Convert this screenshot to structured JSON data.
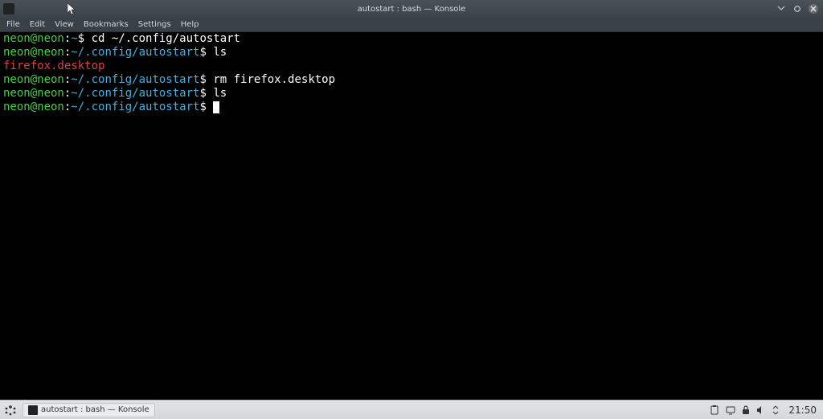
{
  "titlebar": {
    "title": "autostart : bash — Konsole"
  },
  "menubar": {
    "items": [
      "File",
      "Edit",
      "View",
      "Bookmarks",
      "Settings",
      "Help"
    ]
  },
  "terminal": {
    "lines": [
      {
        "user": "neon@neon",
        "path": "~",
        "command": "cd ~/.config/autostart"
      },
      {
        "user": "neon@neon",
        "path": "~/.config/autostart",
        "command": "ls"
      },
      {
        "output": "firefox.desktop",
        "class": "out-red"
      },
      {
        "user": "neon@neon",
        "path": "~/.config/autostart",
        "command": "rm firefox.desktop"
      },
      {
        "user": "neon@neon",
        "path": "~/.config/autostart",
        "command": "ls"
      },
      {
        "user": "neon@neon",
        "path": "~/.config/autostart",
        "command": "",
        "cursor": true
      }
    ]
  },
  "taskbar": {
    "task": "autostart : bash — Konsole",
    "clock": "21:50"
  }
}
